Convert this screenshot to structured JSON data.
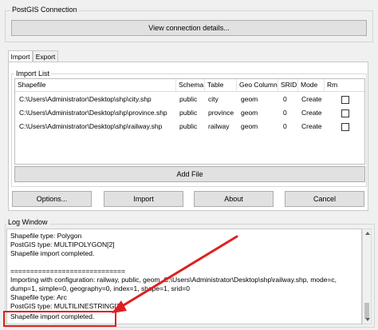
{
  "connection": {
    "group_title": "PostGIS Connection",
    "view_button": "View connection details..."
  },
  "tabs": [
    {
      "label": "Import",
      "active": true
    },
    {
      "label": "Export",
      "active": false
    }
  ],
  "import_list": {
    "title": "Import List",
    "columns": [
      "Shapefile",
      "Schema",
      "Table",
      "Geo Column",
      "SRID",
      "Mode",
      "Rm"
    ],
    "rows": [
      {
        "shapefile": "C:\\Users\\Administrator\\Desktop\\shp\\city.shp",
        "schema": "public",
        "table": "city",
        "geo_column": "geom",
        "srid": "0",
        "mode": "Create"
      },
      {
        "shapefile": "C:\\Users\\Administrator\\Desktop\\shp\\province.shp",
        "schema": "public",
        "table": "province",
        "geo_column": "geom",
        "srid": "0",
        "mode": "Create"
      },
      {
        "shapefile": "C:\\Users\\Administrator\\Desktop\\shp\\railway.shp",
        "schema": "public",
        "table": "railway",
        "geo_column": "geom",
        "srid": "0",
        "mode": "Create"
      }
    ],
    "add_file": "Add File"
  },
  "actions": {
    "options": "Options...",
    "import": "Import",
    "about": "About",
    "cancel": "Cancel"
  },
  "log": {
    "title": "Log Window",
    "lines": [
      "Shapefile type: Polygon",
      "PostGIS type: MULTIPOLYGON[2]",
      "Shapefile import completed.",
      "",
      "=============================",
      "Importing with configuration: railway, public, geom, C:\\Users\\Administrator\\Desktop\\shp\\railway.shp, mode=c,",
      "dump=1, simple=0, geography=0, index=1, shape=1, srid=0",
      "Shapefile type: Arc",
      "PostGIS type: MULTILINESTRING[2]",
      "Shapefile import completed."
    ]
  },
  "colors": {
    "annotation_red": "#e02020"
  }
}
